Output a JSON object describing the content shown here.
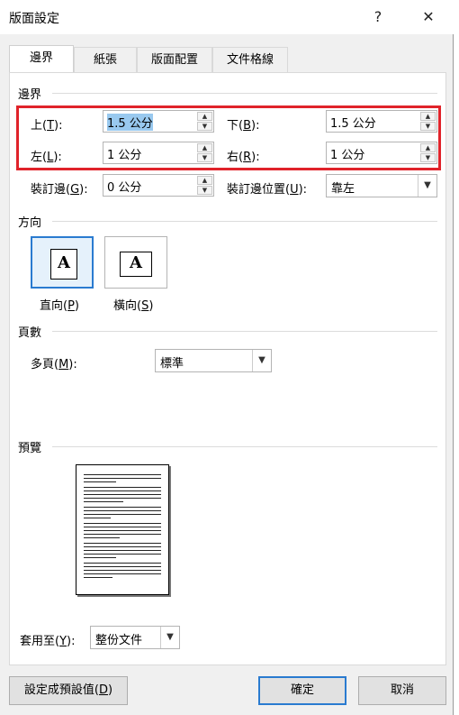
{
  "window": {
    "title": "版面設定",
    "help": "?",
    "close": "✕"
  },
  "tabs": [
    "邊界",
    "紙張",
    "版面配置",
    "文件格線"
  ],
  "margins": {
    "section": "邊界",
    "top_label": "上(",
    "top_key": "T",
    "top_tail": "):",
    "top_value": "1.5 公分",
    "bottom_label": "下(",
    "bottom_key": "B",
    "bottom_tail": "):",
    "bottom_value": "1.5 公分",
    "left_label": "左(",
    "left_key": "L",
    "left_tail": "):",
    "left_value": "1 公分",
    "right_label": "右(",
    "right_key": "R",
    "right_tail": "):",
    "right_value": "1 公分",
    "gutter_label": "裝訂邊(",
    "gutter_key": "G",
    "gutter_tail": "):",
    "gutter_value": "0 公分",
    "gutterpos_label": "裝訂邊位置(",
    "gutterpos_key": "U",
    "gutterpos_tail": "):",
    "gutterpos_value": "靠左"
  },
  "orientation": {
    "section": "方向",
    "portrait_label": "直向(",
    "portrait_key": "P",
    "portrait_tail": ")",
    "landscape_label": "橫向(",
    "landscape_key": "S",
    "landscape_tail": ")",
    "glyph": "A"
  },
  "pages": {
    "section": "頁數",
    "multi_label": "多頁(",
    "multi_key": "M",
    "multi_tail": "):",
    "multi_value": "標準"
  },
  "preview": {
    "section": "預覽",
    "apply_label": "套用至(",
    "apply_key": "Y",
    "apply_tail": "):",
    "apply_value": "整份文件"
  },
  "buttons": {
    "default_label": "設定成預設值(",
    "default_key": "D",
    "default_tail": ")",
    "ok": "確定",
    "cancel": "取消"
  },
  "colors": {
    "highlight_border": "#e0232a",
    "selection": "#99c9ef",
    "accent": "#2a7bd0"
  }
}
